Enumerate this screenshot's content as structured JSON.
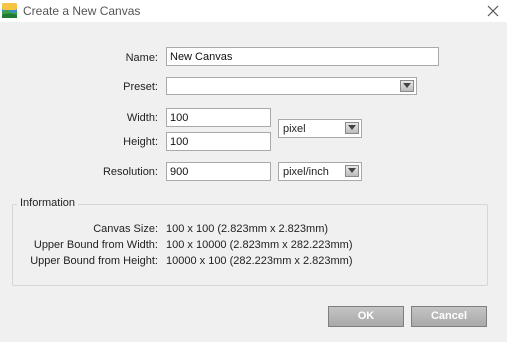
{
  "window": {
    "title": "Create a New Canvas",
    "app_icon": "landscape-icon",
    "close_icon": "close-icon"
  },
  "form": {
    "name_label": "Name:",
    "name_value": "New Canvas",
    "preset_label": "Preset:",
    "preset_value": "",
    "width_label": "Width:",
    "width_value": "100",
    "height_label": "Height:",
    "height_value": "100",
    "unit_value": "pixel",
    "resolution_label": "Resolution:",
    "resolution_value": "900",
    "resolution_unit_value": "pixel/inch"
  },
  "info": {
    "legend": "Information",
    "canvas_size_label": "Canvas Size:",
    "canvas_size_value": "100 x 100 (2.823mm x 2.823mm)",
    "upper_width_label": "Upper Bound from Width:",
    "upper_width_value": "100 x 10000 (2.823mm x 282.223mm)",
    "upper_height_label": "Upper Bound from Height:",
    "upper_height_value": "10000 x 100 (282.223mm x 2.823mm)"
  },
  "buttons": {
    "ok": "OK",
    "cancel": "Cancel"
  }
}
